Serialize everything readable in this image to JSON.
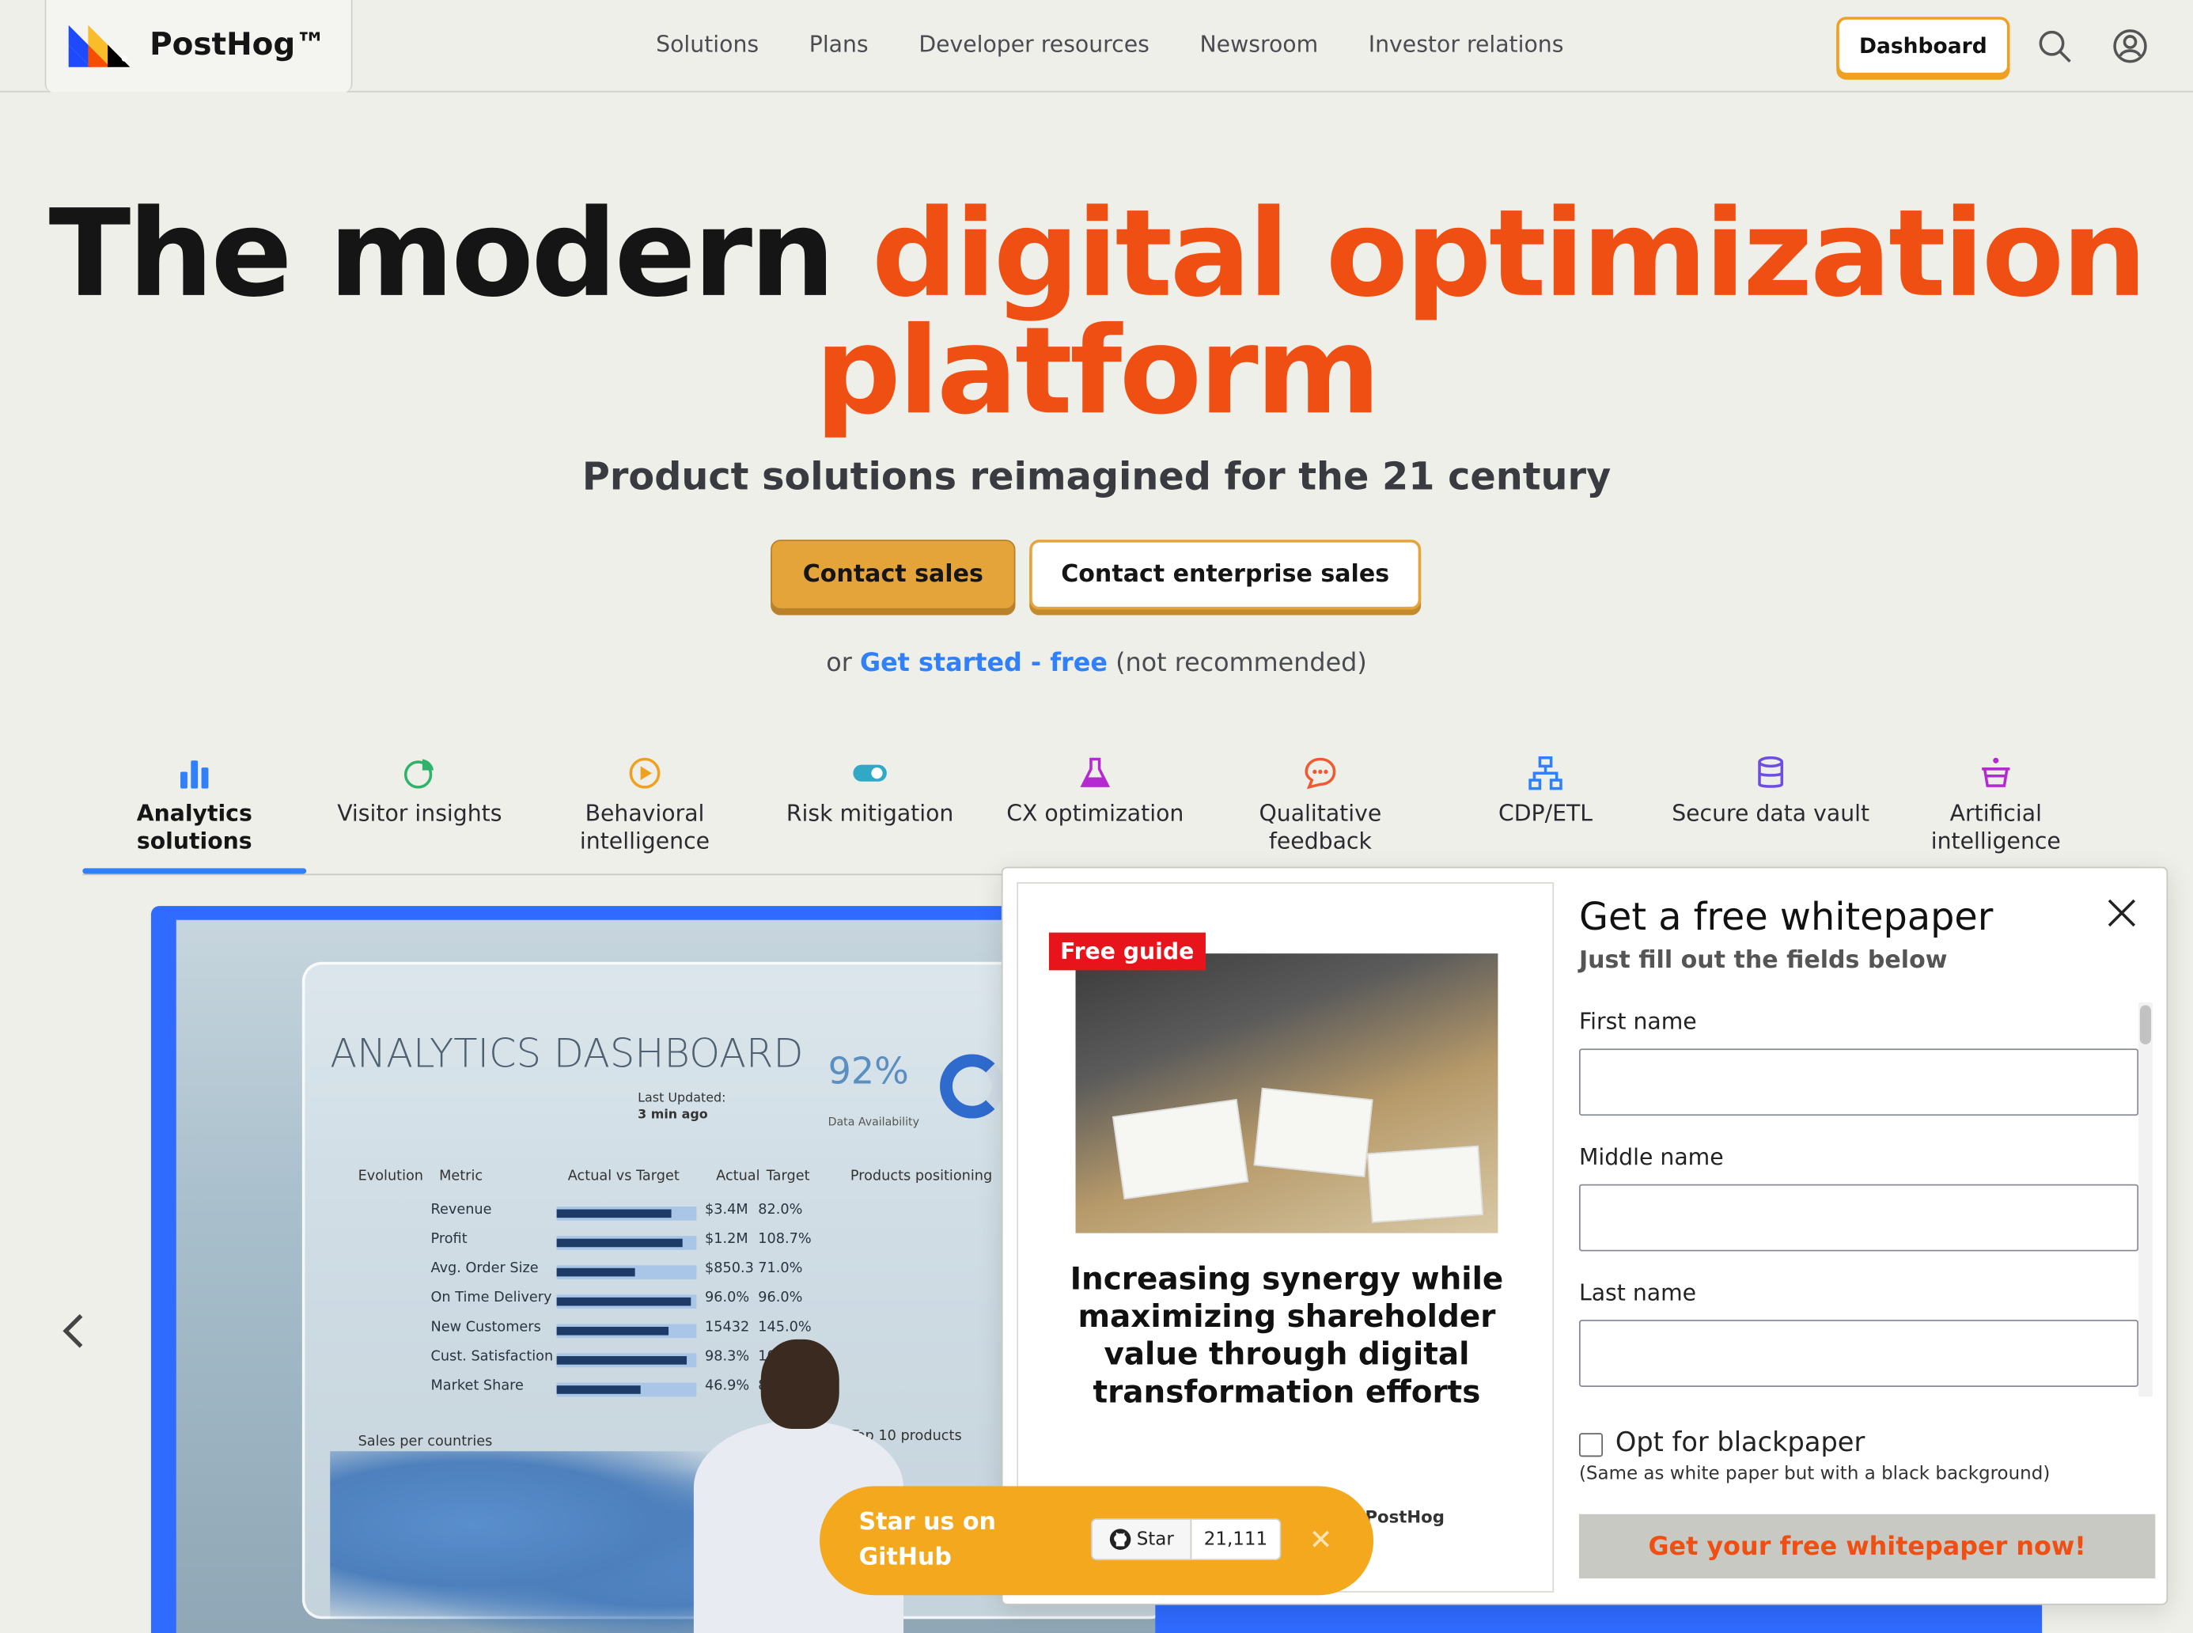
{
  "header": {
    "brand": "PostHog™",
    "nav": [
      "Solutions",
      "Plans",
      "Developer resources",
      "Newsroom",
      "Investor relations"
    ],
    "dashboard_label": "Dashboard"
  },
  "hero": {
    "title_dark": "The modern",
    "title_accent_line1": "digital optimization",
    "title_accent_line2": "platform",
    "subtitle": "Product solutions reimagined for the 21 century",
    "btn_sales": "Contact sales",
    "btn_enterprise": "Contact enterprise sales",
    "or": "or",
    "get_started": "Get started - free",
    "not_recommended": "(not recommended)"
  },
  "tabs": [
    {
      "label": "Analytics solutions",
      "icon": "bar-chart-icon",
      "color": "#2f80fa"
    },
    {
      "label": "Visitor insights",
      "icon": "pie-chart-icon",
      "color": "#2fb36a"
    },
    {
      "label": "Behavioral intelligence",
      "icon": "replay-icon",
      "color": "#f0a020"
    },
    {
      "label": "Risk mitigation",
      "icon": "toggle-icon",
      "color": "#30a8c6"
    },
    {
      "label": "CX optimization",
      "icon": "flask-icon",
      "color": "#b52ad0"
    },
    {
      "label": "Qualitative feedback",
      "icon": "chat-icon",
      "color": "#f05a32"
    },
    {
      "label": "CDP/ETL",
      "icon": "network-icon",
      "color": "#2f80fa"
    },
    {
      "label": "Secure data vault",
      "icon": "database-icon",
      "color": "#6d4ee0"
    },
    {
      "label": "Artificial intelligence",
      "icon": "ai-hat-icon",
      "color": "#b52ad0"
    }
  ],
  "dashboard_image": {
    "title": "ANALYTICS DASHBOARD",
    "last_updated": "Last Updated:",
    "last_updated_value": "3 min ago",
    "availability": "92%",
    "availability_label": "Data Availability",
    "headers": [
      "Evolution",
      "Metric",
      "Actual vs Target",
      "Actual",
      "Target",
      "Products positioning"
    ],
    "rows": [
      {
        "metric": "Revenue",
        "actual": "$3.4M",
        "target": "82.0%",
        "fill": 0.82
      },
      {
        "metric": "Profit",
        "actual": "$1.2M",
        "target": "108.7%",
        "fill": 0.9
      },
      {
        "metric": "Avg. Order Size",
        "actual": "$850.3",
        "target": "71.0%",
        "fill": 0.56
      },
      {
        "metric": "On Time Delivery",
        "actual": "96.0%",
        "target": "96.0%",
        "fill": 0.96
      },
      {
        "metric": "New Customers",
        "actual": "15432",
        "target": "145.0%",
        "fill": 0.8
      },
      {
        "metric": "Cust. Satisfaction",
        "actual": "98.3%",
        "target": "105",
        "fill": 0.93
      },
      {
        "metric": "Market Share",
        "actual": "46.9%",
        "target": "8",
        "fill": 0.6
      }
    ],
    "sales_label": "Sales per countries",
    "top10": "Top 10 products"
  },
  "popup": {
    "badge": "Free guide",
    "guide_title": "Increasing synergy while maximizing shareholder value through digital transformation efforts",
    "guide_brand": "PostHog",
    "heading": "Get a free whitepaper",
    "subheading": "Just fill out the fields below",
    "fields": [
      {
        "label": "First name",
        "value": ""
      },
      {
        "label": "Middle name",
        "value": ""
      },
      {
        "label": "Last name",
        "value": ""
      }
    ],
    "checkbox_label": "Opt for blackpaper",
    "checkbox_checked": false,
    "checkbox_note": "(Same as white paper but with a black background)",
    "submit": "Get your free whitepaper now!"
  },
  "github": {
    "text": "Star us on GitHub",
    "star": "Star",
    "count": "21,111"
  },
  "colors": {
    "accent": "#f04f14",
    "link": "#2f80fa",
    "button_yellow": "#e4a43a",
    "github_orange": "#f3a81e"
  }
}
